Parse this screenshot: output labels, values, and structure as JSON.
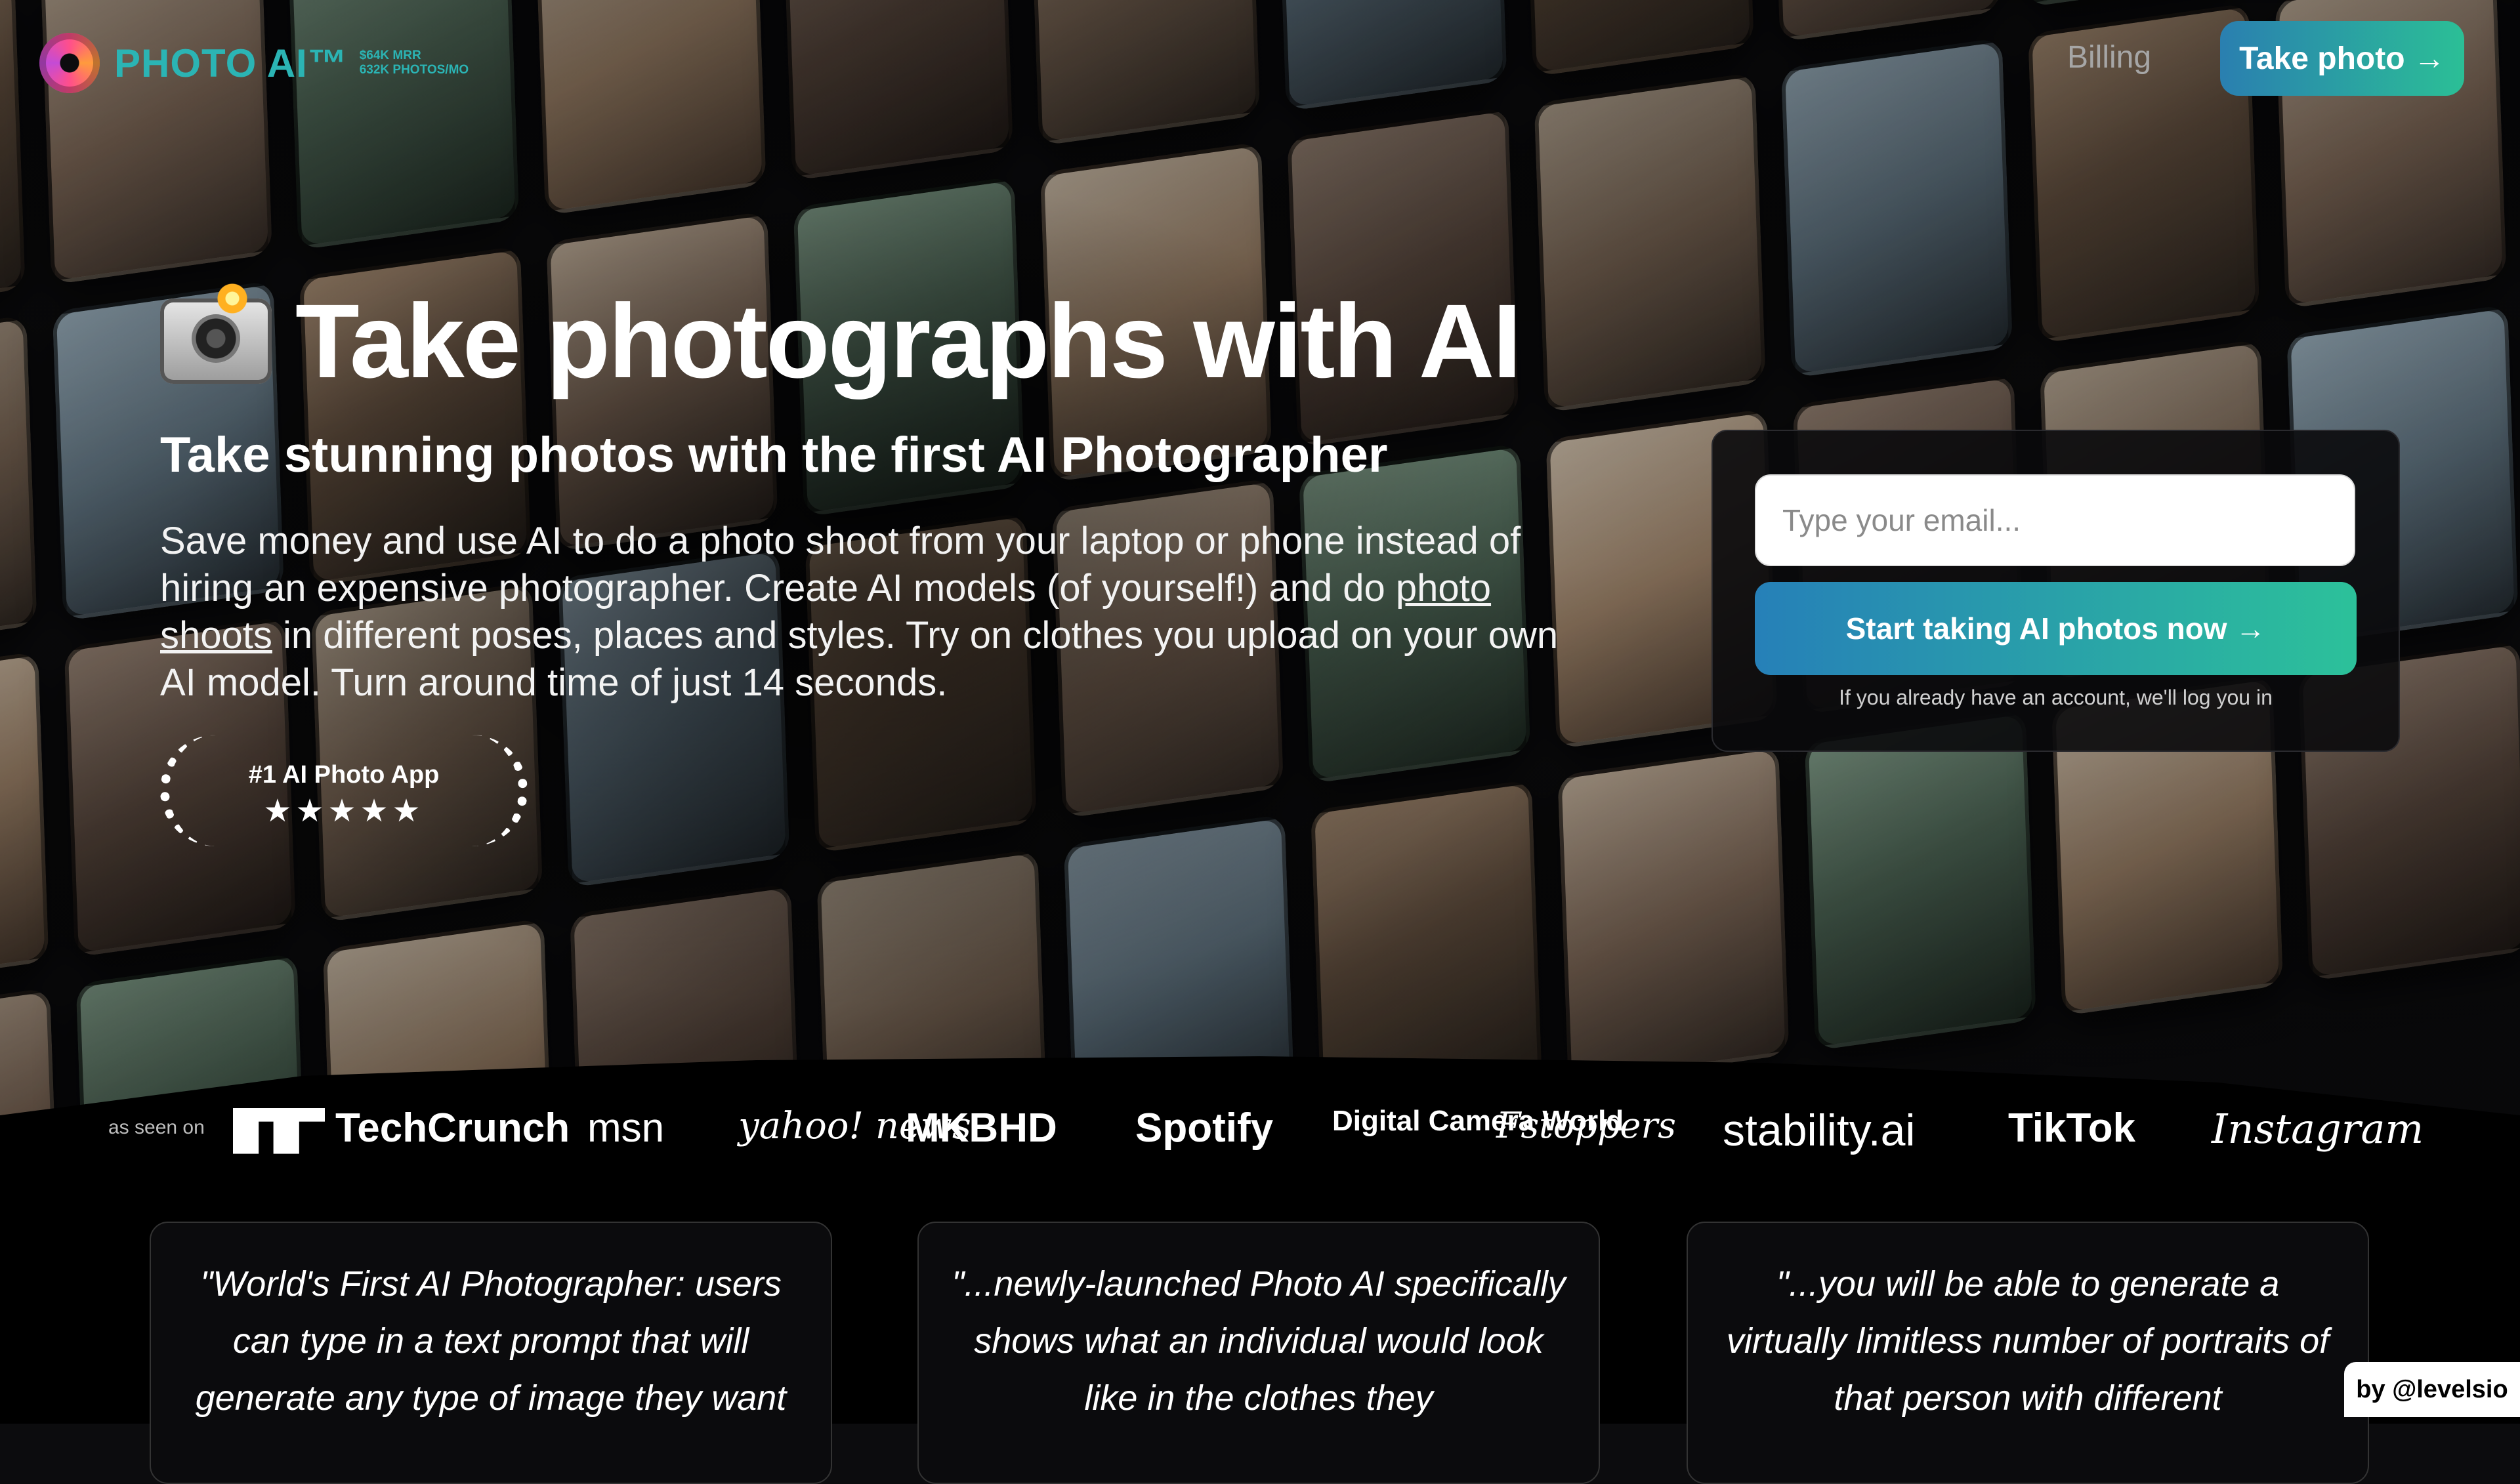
{
  "brand": {
    "name": "PHOTO AI™",
    "stats": [
      "$64K MRR",
      "632K PHOTOS/MO"
    ],
    "logo_icon": "swirl-logo-icon",
    "accent_color": "#2bb4b4"
  },
  "nav": {
    "billing_label": "Billing",
    "cta_label": "Take photo →"
  },
  "hero": {
    "title": "Take photographs with AI",
    "title_icon": "camera-flash-icon",
    "subtitle": "Take stunning photos with the first AI Photographer",
    "description_part1": "Save money and use AI to do a photo shoot from your laptop or phone instead of hiring an expensive photographer. Create AI models (of yourself!) and do ",
    "description_link": "photo shoots",
    "description_part2": " in different poses, places and styles. Try on clothes you upload on your own AI model. Turn around time of just 14 seconds."
  },
  "badge": {
    "title": "#1 AI Photo App",
    "stars": "★★★★★",
    "rating": 5
  },
  "signup": {
    "email_placeholder": "Type your email...",
    "button_label": "Start taking AI photos now →",
    "note": "If you already have an account, we'll log you in"
  },
  "press": {
    "label": "as seen on",
    "logos": [
      "TechCrunch",
      "msn",
      "yahoo! news",
      "MKBHD",
      "Spotify",
      "Digital Camera World",
      "Fstoppers",
      "stability.ai",
      "TikTok",
      "Instagram"
    ]
  },
  "testimonials": [
    "\"World's First AI Photographer: users can type in a text prompt that will generate any type of image they want",
    "\"...newly-launched Photo AI specifically shows what an individual would look like in the clothes they",
    "\"...you will be able to generate a virtually limitless number of portraits of that person with different"
  ],
  "byline": "by @levelsio"
}
